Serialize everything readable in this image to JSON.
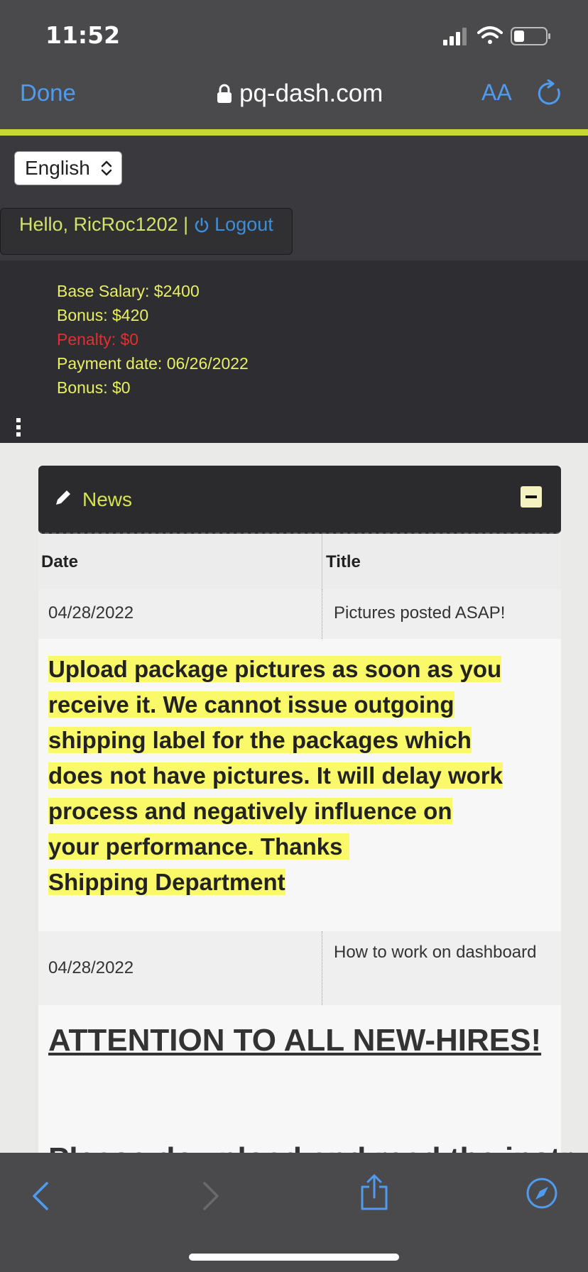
{
  "status": {
    "time": "11:52"
  },
  "browser": {
    "done_label": "Done",
    "url": "pq-dash.com",
    "text_size_label": "AA"
  },
  "language": {
    "selected": "English"
  },
  "user": {
    "greeting": "Hello, RicRoc1202 |",
    "logout_label": "Logout"
  },
  "account_info": [
    {
      "text": "Base Salary: $2400",
      "color": "#e8ef64"
    },
    {
      "text": "Bonus: $420",
      "color": "#e8ef64"
    },
    {
      "text": "Penalty: $0",
      "color": "#e0302f"
    },
    {
      "text": "Payment date: 06/26/2022",
      "color": "#e8ef64"
    },
    {
      "text": "Bonus: $0",
      "color": "#e8ef64"
    }
  ],
  "news": {
    "title": "News",
    "columns": {
      "date": "Date",
      "title": "Title"
    },
    "items": [
      {
        "date": "04/28/2022",
        "title": "Pictures posted ASAP!",
        "body_lines": [
          "Upload package pictures as soon as you",
          "receive it. We cannot issue outgoing",
          "shipping label for the packages which",
          "does not have pictures. It will delay work",
          "process and negatively influence on",
          "your performance. Thanks ",
          "Shipping Department"
        ]
      },
      {
        "date": "04/28/2022",
        "title": "How to work on dashboard",
        "body_heading": "ATTENTION TO ALL NEW-HIRES!",
        "body_next_partial": "Please download and read the instructions"
      }
    ]
  },
  "colors": {
    "accent": "#c5da2c",
    "link": "#4e9bf0",
    "highlight": "#faf96a"
  }
}
